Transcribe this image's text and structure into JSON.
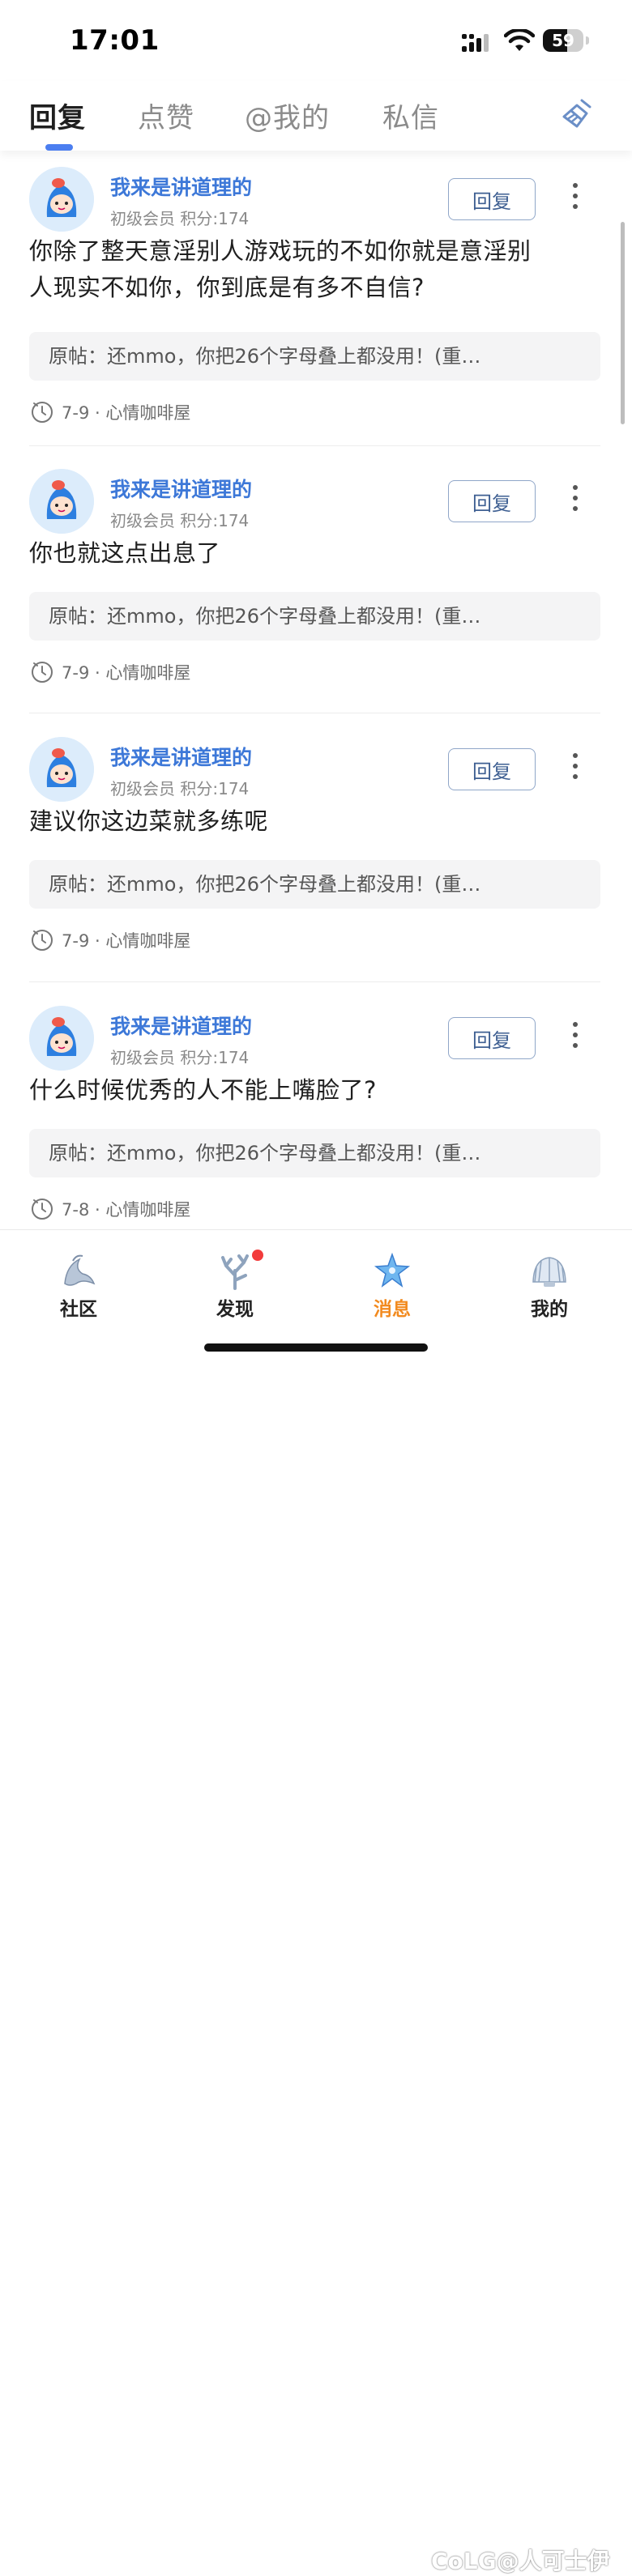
{
  "status": {
    "time": "17:01",
    "battery": "59",
    "battery_level": 0.59
  },
  "tabs": [
    {
      "label": "回复",
      "active": true
    },
    {
      "label": "点赞",
      "active": false
    },
    {
      "label": "@我的",
      "active": false
    },
    {
      "label": "私信",
      "active": false
    }
  ],
  "header": {
    "clear_icon": "broom-icon"
  },
  "items": [
    {
      "username": "我来是讲道理的",
      "meta": "初级会员 积分:174",
      "reply_label": "回复",
      "comment_lines": [
        "你除了整天意淫别人游戏玩的不如你就是意淫别",
        "人现实不如你，你到底是有多不自信?"
      ],
      "original": "原帖：还mmo，你把26个字母叠上都没用！(重…",
      "date": "7-9",
      "board": "心情咖啡屋"
    },
    {
      "username": "我来是讲道理的",
      "meta": "初级会员 积分:174",
      "reply_label": "回复",
      "comment_lines": [
        "你也就这点出息了"
      ],
      "original": "原帖：还mmo，你把26个字母叠上都没用！(重…",
      "date": "7-9",
      "board": "心情咖啡屋"
    },
    {
      "username": "我来是讲道理的",
      "meta": "初级会员 积分:174",
      "reply_label": "回复",
      "comment_lines": [
        "建议你这边菜就多练呢"
      ],
      "original": "原帖：还mmo，你把26个字母叠上都没用！(重…",
      "date": "7-9",
      "board": "心情咖啡屋"
    },
    {
      "username": "我来是讲道理的",
      "meta": "初级会员 积分:174",
      "reply_label": "回复",
      "comment_lines": [
        "什么时候优秀的人不能上嘴脸了?"
      ],
      "original": "原帖：还mmo，你把26个字母叠上都没用！(重…",
      "date": "7-8",
      "board": "心情咖啡屋"
    }
  ],
  "meta_separator": " · ",
  "nav": [
    {
      "label": "社区",
      "icon": "community-icon",
      "active": false
    },
    {
      "label": "发现",
      "icon": "discover-icon",
      "active": false,
      "badge": true
    },
    {
      "label": "消息",
      "icon": "message-icon",
      "active": true
    },
    {
      "label": "我的",
      "icon": "profile-icon",
      "active": false
    }
  ],
  "watermark": "CoLG@人可士伊",
  "colors": {
    "accent": "#4b7ef0",
    "username": "#3d78d8",
    "active_nav": "#f28a1e",
    "badge": "#f23b3b"
  }
}
